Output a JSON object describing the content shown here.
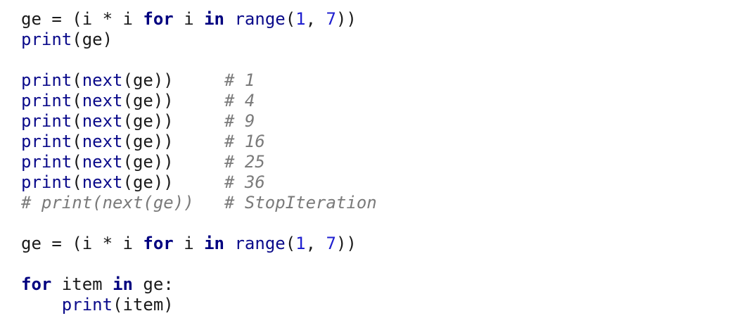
{
  "code": {
    "lines": [
      [
        [
          "plain",
          "ge = (i * i "
        ],
        [
          "kw",
          "for"
        ],
        [
          "plain",
          " i "
        ],
        [
          "kw",
          "in"
        ],
        [
          "plain",
          " "
        ],
        [
          "builtin",
          "range"
        ],
        [
          "plain",
          "("
        ],
        [
          "num",
          "1"
        ],
        [
          "plain",
          ", "
        ],
        [
          "num",
          "7"
        ],
        [
          "plain",
          "))"
        ]
      ],
      [
        [
          "builtin",
          "print"
        ],
        [
          "plain",
          "(ge)"
        ]
      ],
      [],
      [
        [
          "builtin",
          "print"
        ],
        [
          "plain",
          "("
        ],
        [
          "builtin",
          "next"
        ],
        [
          "plain",
          "(ge))     "
        ],
        [
          "comment",
          "# 1"
        ]
      ],
      [
        [
          "builtin",
          "print"
        ],
        [
          "plain",
          "("
        ],
        [
          "builtin",
          "next"
        ],
        [
          "plain",
          "(ge))     "
        ],
        [
          "comment",
          "# 4"
        ]
      ],
      [
        [
          "builtin",
          "print"
        ],
        [
          "plain",
          "("
        ],
        [
          "builtin",
          "next"
        ],
        [
          "plain",
          "(ge))     "
        ],
        [
          "comment",
          "# 9"
        ]
      ],
      [
        [
          "builtin",
          "print"
        ],
        [
          "plain",
          "("
        ],
        [
          "builtin",
          "next"
        ],
        [
          "plain",
          "(ge))     "
        ],
        [
          "comment",
          "# 16"
        ]
      ],
      [
        [
          "builtin",
          "print"
        ],
        [
          "plain",
          "("
        ],
        [
          "builtin",
          "next"
        ],
        [
          "plain",
          "(ge))     "
        ],
        [
          "comment",
          "# 25"
        ]
      ],
      [
        [
          "builtin",
          "print"
        ],
        [
          "plain",
          "("
        ],
        [
          "builtin",
          "next"
        ],
        [
          "plain",
          "(ge))     "
        ],
        [
          "comment",
          "# 36"
        ]
      ],
      [
        [
          "comment",
          "# print(next(ge))   # StopIteration"
        ]
      ],
      [],
      [
        [
          "plain",
          "ge = (i * i "
        ],
        [
          "kw",
          "for"
        ],
        [
          "plain",
          " i "
        ],
        [
          "kw",
          "in"
        ],
        [
          "plain",
          " "
        ],
        [
          "builtin",
          "range"
        ],
        [
          "plain",
          "("
        ],
        [
          "num",
          "1"
        ],
        [
          "plain",
          ", "
        ],
        [
          "num",
          "7"
        ],
        [
          "plain",
          "))"
        ]
      ],
      [],
      [
        [
          "kw",
          "for"
        ],
        [
          "plain",
          " item "
        ],
        [
          "kw",
          "in"
        ],
        [
          "plain",
          " ge:"
        ]
      ],
      [
        [
          "plain",
          "    "
        ],
        [
          "builtin",
          "print"
        ],
        [
          "plain",
          "(item)"
        ]
      ]
    ]
  },
  "colors": {
    "keyword": "#00007f",
    "builtin": "#0a0a8a",
    "number": "#1f1fd0",
    "comment": "#7a7a7a",
    "text": "#1a1a1a",
    "background": "#ffffff"
  }
}
